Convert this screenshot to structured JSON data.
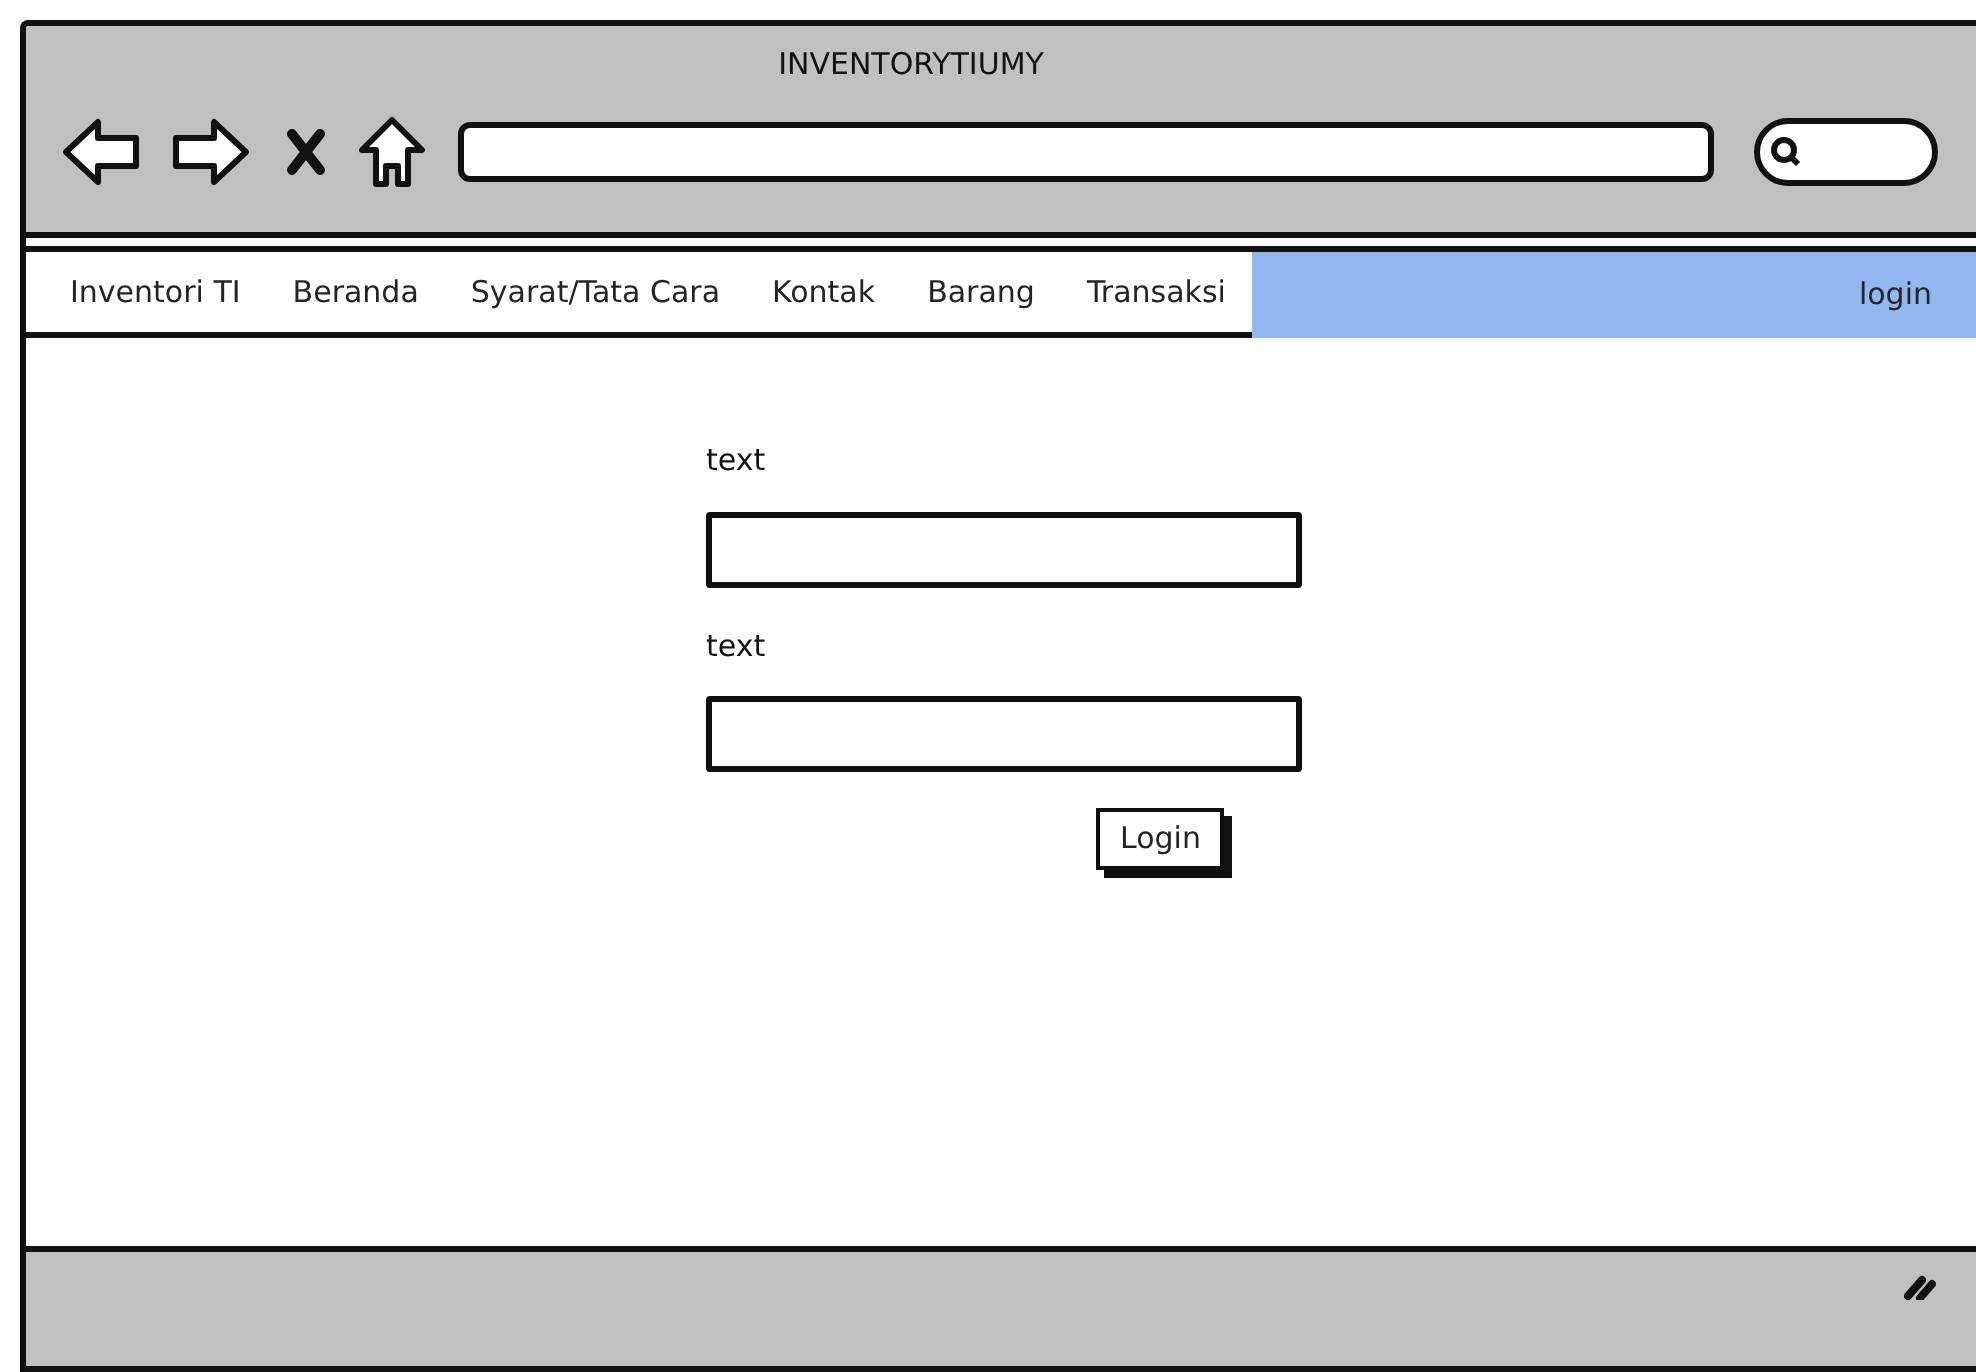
{
  "window": {
    "title": "INVENTORYTIUMY"
  },
  "nav": {
    "items": [
      {
        "label": "Inventori TI",
        "selected": false
      },
      {
        "label": "Beranda",
        "selected": false
      },
      {
        "label": "Syarat/Tata Cara",
        "selected": false
      },
      {
        "label": "Kontak",
        "selected": false
      },
      {
        "label": "Barang",
        "selected": false
      },
      {
        "label": "Transaksi",
        "selected": false
      },
      {
        "label": "login",
        "selected": true
      }
    ]
  },
  "form": {
    "fields": [
      {
        "label": "text"
      },
      {
        "label": "text"
      }
    ],
    "button": "Login"
  }
}
